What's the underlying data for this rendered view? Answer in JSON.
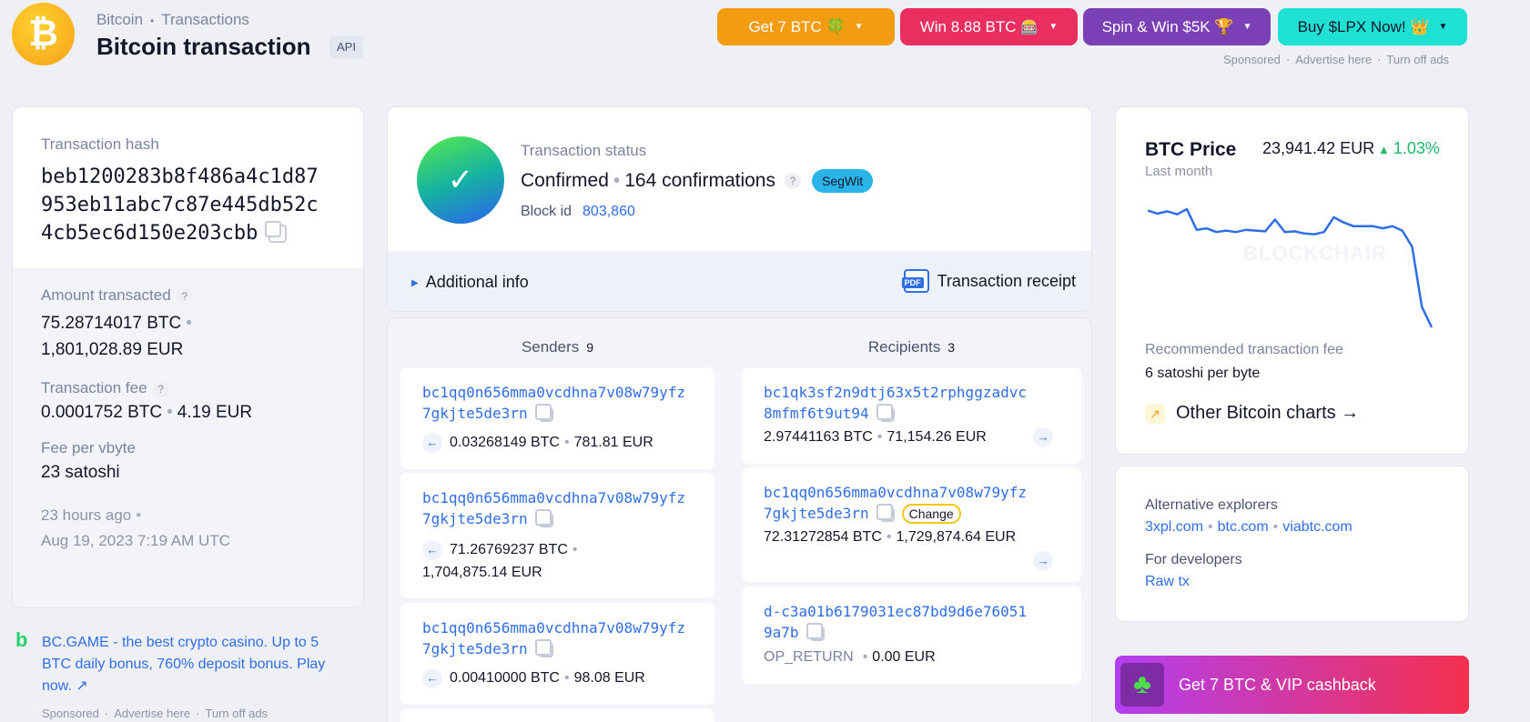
{
  "header": {
    "breadcrumb_1": "Bitcoin",
    "breadcrumb_2": "Transactions",
    "title": "Bitcoin transaction",
    "api_badge": "API"
  },
  "ads": {
    "buttons": [
      {
        "label": "Get 7 BTC 🍀",
        "color": "#f39c12"
      },
      {
        "label": "Win 8.88 BTC 🎰",
        "color": "#ea2e60"
      },
      {
        "label": "Spin & Win $5K 🏆",
        "color": "#7b3fb6"
      },
      {
        "label": "Buy $LPX Now! 👑",
        "color": "#1ee0d3"
      }
    ],
    "sponsored": "Sponsored",
    "advertise": "Advertise here",
    "turn_off": "Turn off ads"
  },
  "summary": {
    "hash_label": "Transaction hash",
    "hash_line1": "beb1200283b8f486a4c1d87",
    "hash_line2": "953eb11abc7c87e445db52c",
    "hash_line3": "4cb5ec6d150e203cbb",
    "amount_label": "Amount transacted",
    "amount_btc": "75.28714017 BTC",
    "amount_eur": "1,801,028.89 EUR",
    "fee_label": "Transaction fee",
    "fee_btc": "0.0001752 BTC",
    "fee_eur": "4.19 EUR",
    "fee_vbyte_label": "Fee per vbyte",
    "fee_vbyte": "23 satoshi",
    "time_ago": "23 hours ago",
    "datetime": "Aug 19, 2023 7:19 AM UTC"
  },
  "side_ad": {
    "text": "BC.GAME - the best crypto casino. Up to 5 BTC daily bonus, 760% deposit bonus. Play now.",
    "arrow": "↗",
    "sponsored": "Sponsored",
    "advertise": "Advertise here",
    "turn_off": "Turn off ads"
  },
  "status": {
    "label": "Transaction status",
    "state": "Confirmed",
    "confirmations": "164 confirmations",
    "badge": "SegWit",
    "block_label": "Block id",
    "block_id": "803,860",
    "additional_info": "Additional info",
    "receipt": "Transaction receipt",
    "pdf": "PDF"
  },
  "senders": {
    "label": "Senders",
    "count": "9",
    "items": [
      {
        "addr1": "bc1qq0n656mma0vcdhna7v08w79yfz",
        "addr2": "7gkjte5de3rn",
        "btc": "0.03268149 BTC",
        "eur": "781.81 EUR"
      },
      {
        "addr1": "bc1qq0n656mma0vcdhna7v08w79yfz",
        "addr2": "7gkjte5de3rn",
        "btc": "71.26769237 BTC",
        "eur": "1,704,875.14 EUR"
      },
      {
        "addr1": "bc1qq0n656mma0vcdhna7v08w79yfz",
        "addr2": "7gkjte5de3rn",
        "btc": "0.00410000 BTC",
        "eur": "98.08 EUR"
      }
    ]
  },
  "recipients": {
    "label": "Recipients",
    "count": "3",
    "items": [
      {
        "addr1": "bc1qk3sf2n9dtj63x5t2rphggzadvc",
        "addr2": "8mfmf6t9ut94",
        "btc": "2.97441163 BTC",
        "eur": "71,154.26 EUR"
      },
      {
        "addr1": "bc1qq0n656mma0vcdhna7v08w79yfz",
        "addr2": "7gkjte5de3rn",
        "badge": "Change",
        "btc": "72.31272854 BTC",
        "eur": "1,729,874.64 EUR"
      },
      {
        "addr1": "d-c3a01b6179031ec87bd9d6e76051",
        "addr2": "9a7b",
        "btc": "OP_RETURN",
        "eur": "0.00 EUR"
      }
    ]
  },
  "price": {
    "title": "BTC Price",
    "value": "23,941.42 EUR",
    "change": "1.03%",
    "period": "Last month",
    "watermark": "BLOCKCHAIR",
    "fee_label": "Recommended transaction fee",
    "fee_value": "6 satoshi per byte",
    "charts_link": "Other Bitcoin charts →",
    "series": [
      23,
      22.6,
      22.9,
      22.5,
      23.2,
      20.4,
      20.6,
      20.1,
      20.3,
      20.1,
      20.4,
      20.3,
      20.2,
      21.8,
      20.1,
      20.2,
      19.9,
      19.8,
      20.1,
      22.1,
      21.4,
      20.9,
      20.9,
      20.9,
      20.6,
      20.9,
      20.3,
      18.1,
      10,
      7.2
    ]
  },
  "links": {
    "alt_label": "Alternative explorers",
    "alt1": "3xpl.com",
    "alt2": "btc.com",
    "alt3": "viabtc.com",
    "dev_label": "For developers",
    "raw": "Raw tx"
  },
  "bottom_ad": {
    "text": "Get 7 BTC & VIP cashback"
  }
}
